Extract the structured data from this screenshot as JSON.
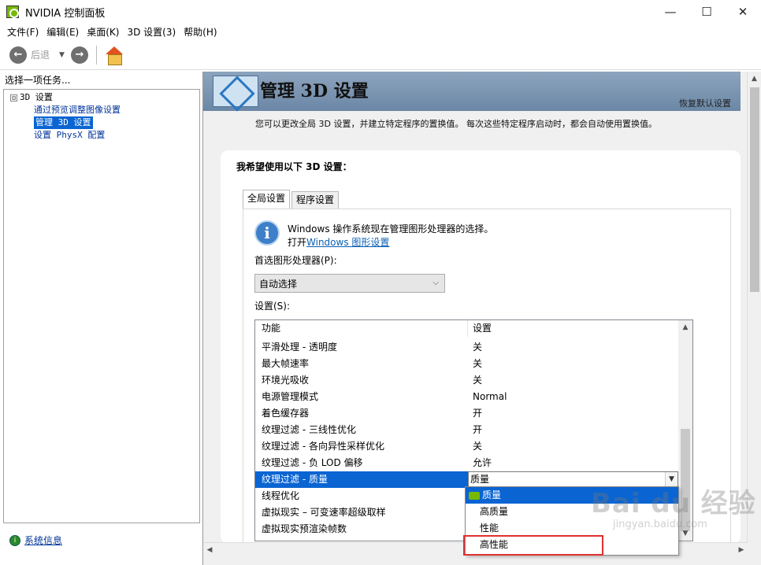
{
  "window": {
    "title": "NVIDIA 控制面板",
    "controls": {
      "minimize": "—",
      "maximize": "☐",
      "close": "✕"
    }
  },
  "menu": [
    "文件(F)",
    "编辑(E)",
    "桌面(K)",
    "3D 设置(3)",
    "帮助(H)"
  ],
  "toolbar": {
    "back_label": "后退",
    "back_glyph": "←",
    "forward_glyph": "→",
    "dropdown_glyph": "▼"
  },
  "task_pane": {
    "header": "选择一项任务...",
    "tree": {
      "root_label": "3D 设置",
      "expander": "⊟",
      "children": [
        {
          "label": "通过预览调整图像设置",
          "selected": false
        },
        {
          "label": "管理 3D 设置",
          "selected": true
        },
        {
          "label": "设置 PhysX 配置",
          "selected": false
        }
      ]
    },
    "system_info": "系统信息"
  },
  "main": {
    "banner_title": "管理 3D 设置",
    "restore_defaults": "恢复默认设置",
    "description": "您可以更改全局 3D 设置，并建立特定程序的置换值。 每次这些特定程序启动时，都会自动使用置换值。",
    "panel_heading": "我希望使用以下 3D 设置：",
    "tabs": [
      {
        "label": "全局设置",
        "active": true
      },
      {
        "label": "程序设置",
        "active": false
      }
    ],
    "info_icon_glyph": "i",
    "info_line1": "Windows 操作系统现在管理图形处理器的选择。",
    "info_line2_prefix": "打开",
    "info_link": "Windows 图形设置",
    "gpu_label": "首选图形处理器(P):",
    "gpu_value": "自动选择",
    "settings_label": "设置(S):",
    "grid": {
      "headers": [
        "功能",
        "设置"
      ],
      "rows": [
        [
          "平滑处理 - 透明度",
          "关"
        ],
        [
          "最大帧速率",
          "关"
        ],
        [
          "环境光吸收",
          "关"
        ],
        [
          "电源管理模式",
          "Normal"
        ],
        [
          "着色缓存器",
          "开"
        ],
        [
          "纹理过滤 - 三线性优化",
          "开"
        ],
        [
          "纹理过滤 - 各向异性采样优化",
          "关"
        ],
        [
          "纹理过滤 - 负 LOD 偏移",
          "允许"
        ],
        [
          "纹理过滤 - 质量",
          "质量"
        ],
        [
          "线程优化",
          ""
        ],
        [
          "虚拟现实 – 可变速率超级取样",
          ""
        ],
        [
          "虚拟现实预渲染帧数",
          ""
        ]
      ],
      "selected_row": 8
    },
    "dropdown_options": [
      "质量",
      "高质量",
      "性能",
      "高性能"
    ]
  },
  "watermark": {
    "main": "Bai du 经验",
    "sub": "jingyan.baidu.com"
  },
  "colors": {
    "selection": "#0a64d2",
    "nvidia_green": "#76b900",
    "highlight_box": "#e03030",
    "link": "#0a5fb4"
  }
}
